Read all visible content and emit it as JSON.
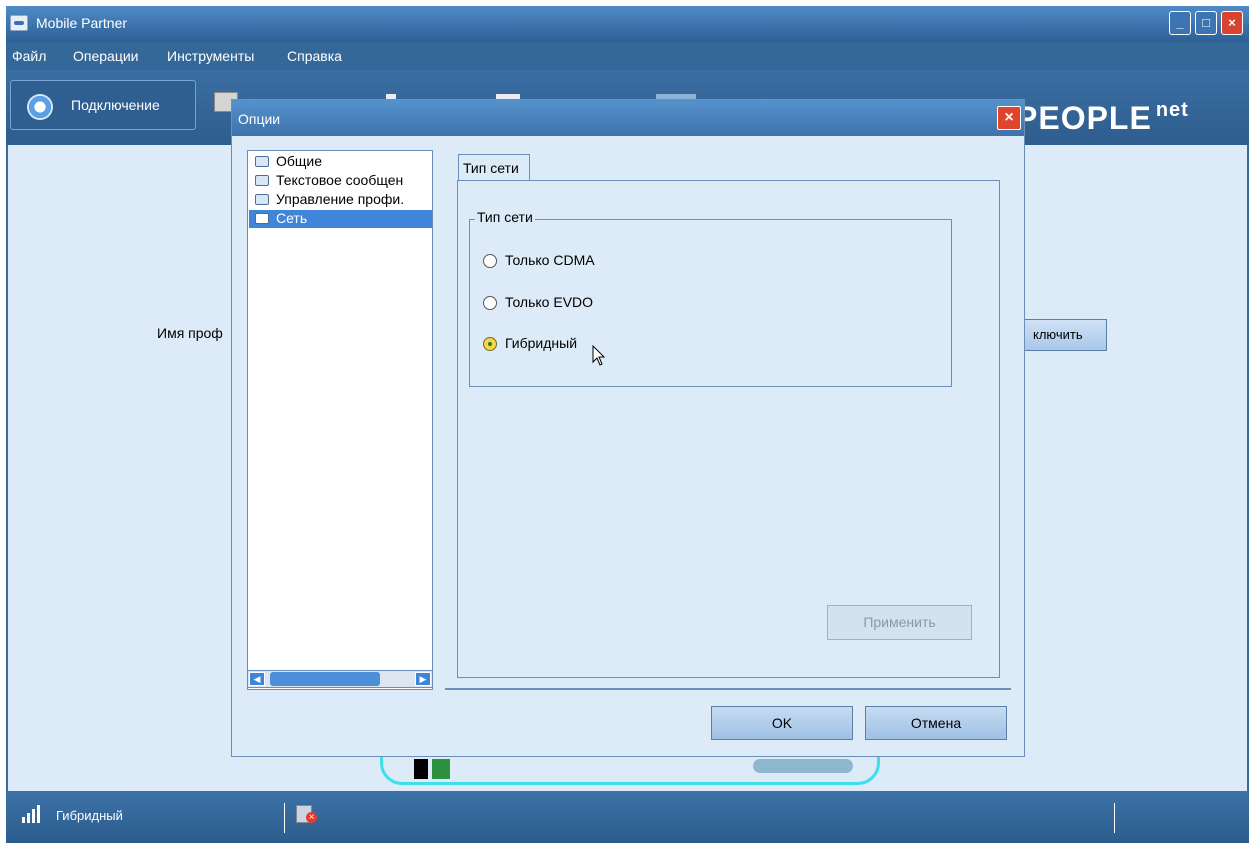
{
  "app": {
    "title": "Mobile Partner"
  },
  "menu": {
    "items": [
      "Файл",
      "Операции",
      "Инструменты",
      "Справка"
    ]
  },
  "toolbar": {
    "connect_label": "Подключение",
    "brand_text": "PEOPLE",
    "brand_suffix": "net"
  },
  "main": {
    "profile_label_partial": "Имя проф",
    "connect_button_partial": "ключить"
  },
  "status": {
    "network_mode": "Гибридный"
  },
  "dialog": {
    "title": "Опции",
    "tree": [
      {
        "label": "Общие",
        "selected": false
      },
      {
        "label": "Текстовое сообщен",
        "selected": false
      },
      {
        "label": "Управление профи.",
        "selected": false
      },
      {
        "label": "Сеть",
        "selected": true
      }
    ],
    "tab_label": "Тип сети",
    "group_label": "Тип сети",
    "options": [
      {
        "label": "Только CDMA",
        "checked": false
      },
      {
        "label": "Только EVDO",
        "checked": false
      },
      {
        "label": "Гибридный",
        "checked": true
      }
    ],
    "apply_label": "Применить",
    "ok_label": "OK",
    "cancel_label": "Отмена"
  },
  "icons": [
    "app-icon",
    "minimize-icon",
    "maximize-icon",
    "close-icon",
    "refresh-icon",
    "monitor-icon",
    "signal-icon",
    "device-disconnected-icon",
    "folder-icon",
    "cursor-icon"
  ],
  "colors": {
    "titlebar": "#3e72ab",
    "selection": "#3f86d9",
    "close_red": "#e0442d",
    "panel_bg": "#ddeaf7"
  }
}
